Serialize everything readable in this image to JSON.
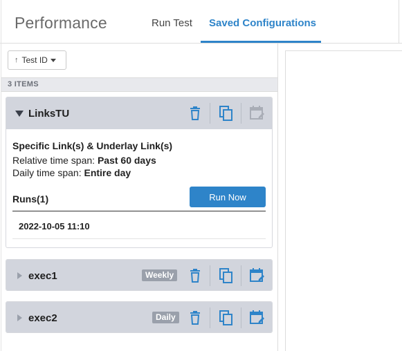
{
  "header": {
    "title": "Performance",
    "tabs": [
      {
        "label": "Run Test",
        "active": false
      },
      {
        "label": "Saved Configurations",
        "active": true
      }
    ]
  },
  "toolbar": {
    "sort_arrow": "↑",
    "sort_label": "Test ID"
  },
  "list": {
    "count_label": "3 ITEMS",
    "items": [
      {
        "name": "LinksTU",
        "expanded": true,
        "badge": "",
        "schedule_icon_active": false,
        "description": "Specific Link(s) & Underlay Link(s)",
        "relative_label": "Relative time span: ",
        "relative_value": "Past 60 days",
        "daily_label": "Daily time span: ",
        "daily_value": "Entire day",
        "runs_label": "Runs(1)",
        "run_now_label": "Run Now",
        "runs": [
          "2022-10-05 11:10"
        ]
      },
      {
        "name": "exec1",
        "expanded": false,
        "badge": "Weekly",
        "schedule_icon_active": true
      },
      {
        "name": "exec2",
        "expanded": false,
        "badge": "Daily",
        "schedule_icon_active": true
      }
    ]
  },
  "colors": {
    "accent": "#2e84c9",
    "card_header": "#d2d5dd",
    "badge_bg": "#9aa0ab",
    "icon_blue": "#2e84c9",
    "icon_disabled": "#a9adb6"
  }
}
